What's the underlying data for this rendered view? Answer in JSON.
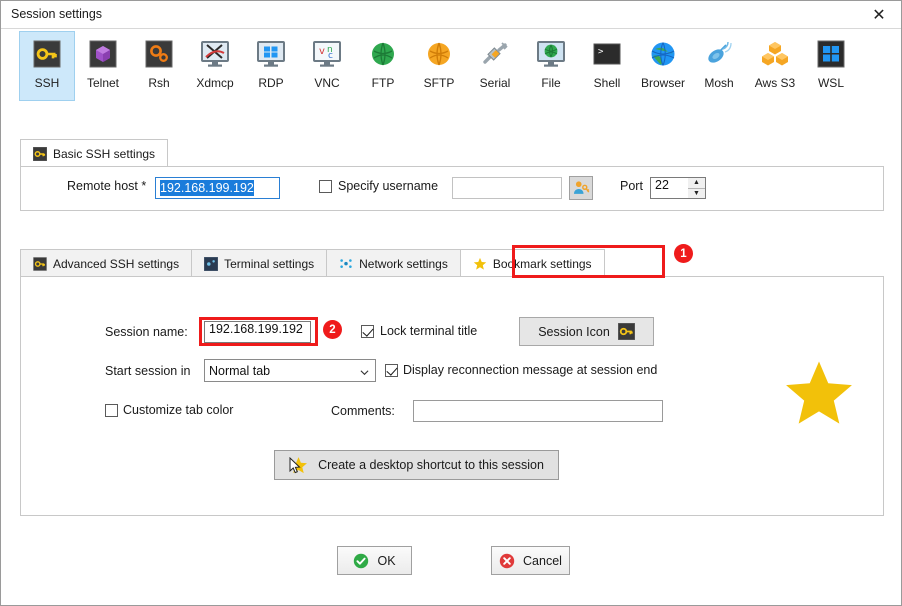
{
  "window": {
    "title": "Session settings",
    "close_label": "✕"
  },
  "protocols": [
    {
      "label": "SSH",
      "icon": "ssh-key-icon",
      "selected": true
    },
    {
      "label": "Telnet",
      "icon": "telnet-cube-icon",
      "selected": false
    },
    {
      "label": "Rsh",
      "icon": "rsh-gears-icon",
      "selected": false
    },
    {
      "label": "Xdmcp",
      "icon": "xdmcp-x-icon",
      "selected": false
    },
    {
      "label": "RDP",
      "icon": "rdp-windows-icon",
      "selected": false
    },
    {
      "label": "VNC",
      "icon": "vnc-monitor-icon",
      "selected": false
    },
    {
      "label": "FTP",
      "icon": "ftp-globe-icon",
      "selected": false
    },
    {
      "label": "SFTP",
      "icon": "sftp-globe-icon",
      "selected": false
    },
    {
      "label": "Serial",
      "icon": "serial-plug-icon",
      "selected": false
    },
    {
      "label": "File",
      "icon": "file-monitor-icon",
      "selected": false
    },
    {
      "label": "Shell",
      "icon": "shell-console-icon",
      "selected": false
    },
    {
      "label": "Browser",
      "icon": "browser-globe-icon",
      "selected": false
    },
    {
      "label": "Mosh",
      "icon": "mosh-satellite-icon",
      "selected": false
    },
    {
      "label": "Aws S3",
      "icon": "aws-s3-buckets-icon",
      "selected": false
    },
    {
      "label": "WSL",
      "icon": "wsl-windows-icon",
      "selected": false
    }
  ],
  "basic": {
    "tab_label": "Basic SSH settings",
    "tab_icon": "ssh-key-icon",
    "remote_host_label": "Remote host *",
    "remote_host_value": "192.168.199.192",
    "specify_username_label": "Specify username",
    "specify_username_checked": false,
    "username_value": "",
    "username_icon": "user-key-icon",
    "port_label": "Port",
    "port_value": "22"
  },
  "tabs": [
    {
      "label": "Advanced SSH settings",
      "icon": "ssh-key-icon",
      "active": false
    },
    {
      "label": "Terminal settings",
      "icon": "terminal-icon",
      "active": false
    },
    {
      "label": "Network settings",
      "icon": "network-dots-icon",
      "active": false
    },
    {
      "label": "Bookmark settings",
      "icon": "star-icon",
      "active": true
    }
  ],
  "bookmark": {
    "session_name_label": "Session name:",
    "session_name_value": "192.168.199.192",
    "lock_terminal_title_label": "Lock terminal title",
    "lock_terminal_title_checked": true,
    "session_icon_button_label": "Session Icon",
    "session_icon_glyph": "ssh-key-icon",
    "start_session_in_label": "Start session in",
    "start_session_in_value": "Normal tab",
    "display_reconnection_label": "Display reconnection message at session end",
    "display_reconnection_checked": true,
    "customize_tab_color_label": "Customize tab color",
    "customize_tab_color_checked": false,
    "comments_label": "Comments:",
    "comments_value": "",
    "shortcut_button_label": "Create a desktop shortcut to this session",
    "decoration_icon": "large-star-icon"
  },
  "footer": {
    "ok_label": "OK",
    "cancel_label": "Cancel"
  },
  "annotations": [
    {
      "badge": "1",
      "target": "bookmark-settings-tab"
    },
    {
      "badge": "2",
      "target": "session-name-input"
    }
  ],
  "colors": {
    "accent_selected": "#cde8fa",
    "annotation_red": "#ef1b1b",
    "star_gold": "#f2c10a",
    "selection_blue": "#1a7cdb",
    "ok_green": "#2faa46",
    "cancel_red": "#e03a3a"
  }
}
